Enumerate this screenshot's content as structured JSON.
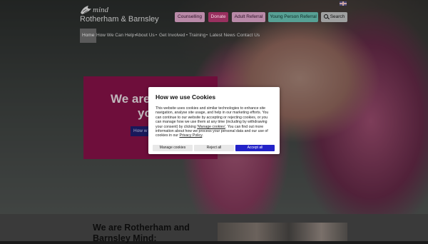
{
  "header": {
    "logo_word": "mind",
    "logo_place": "Rotherham & Barnsley",
    "language_icon": "uk-flag-icon",
    "buttons": {
      "counselling": "Counselling",
      "donate": "Donate",
      "adult_referral": "Adult Referral",
      "young_person_referral": "Young Person Referral",
      "search": "Search"
    }
  },
  "nav": {
    "home": "Home",
    "how_we_can_help": "How We Can Help",
    "about_us": "About Us",
    "get_involved": "Get Involved",
    "training": "Training",
    "latest_news": "Latest News",
    "contact_us": "Contact Us"
  },
  "hero": {
    "heading_part1": "We are",
    "heading_part2": "yo",
    "button_fragment": "How w"
  },
  "lower": {
    "heading": "We are Rotherham and Barnsley Mind:"
  },
  "cookie_modal": {
    "title": "How we use Cookies",
    "body_start": "This website uses cookies and similar technologies to enhance site navigation, analyse site usage, and help in our marketing efforts. You can continue to our website by accepting or rejecting cookies, or you can manage how we use them at any time (including by withdrawing your consent) by clicking ",
    "manage_link": "'Manage cookies'",
    "body_middle": ". You can find out more information about how we process your personal data and our use of cookies in our ",
    "privacy_link": "Privacy Policy",
    "body_end": ".",
    "buttons": {
      "manage": "Manage cookies",
      "reject": "Reject all",
      "accept": "Accept all"
    }
  },
  "colors": {
    "counselling_bg": "#b98aa8",
    "donate_bg": "#99305f",
    "young_person_bg": "#57a195",
    "feature_bg": "#6e0e3b",
    "accept_bg": "#2323c8"
  }
}
